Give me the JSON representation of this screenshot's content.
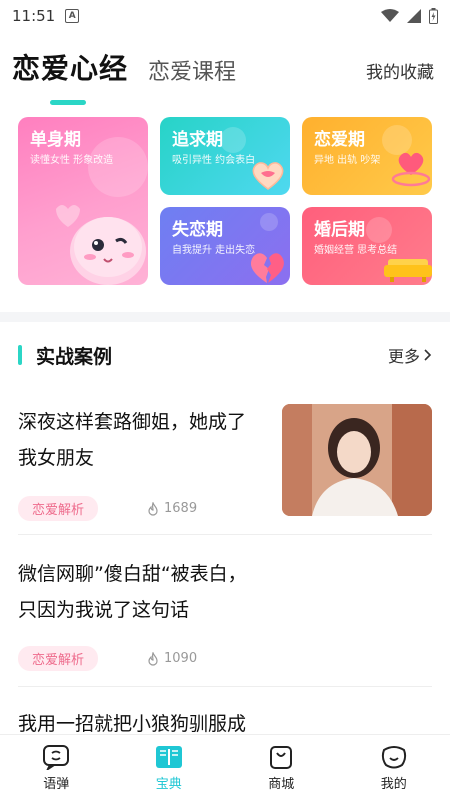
{
  "status": {
    "time": "11:51"
  },
  "nav": {
    "tab_main": "恋爱心经",
    "tab_second": "恋爱课程",
    "favorites": "我的收藏"
  },
  "categories": [
    {
      "title": "单身期",
      "subtitle": "读懂女性 形象改造"
    },
    {
      "title": "追求期",
      "subtitle": "吸引异性 约会表白"
    },
    {
      "title": "恋爱期",
      "subtitle": "异地 出轨 吵架"
    },
    {
      "title": "失恋期",
      "subtitle": "自我提升 走出失恋"
    },
    {
      "title": "婚后期",
      "subtitle": "婚姻经营 思考总结"
    }
  ],
  "section": {
    "title": "实战案例",
    "more": "更多"
  },
  "articles": [
    {
      "line1": "深夜这样套路御姐，她成了",
      "line2": "我女朋友",
      "tag": "恋爱解析",
      "views": "1689"
    },
    {
      "line1": "微信网聊”傻白甜“被表白，",
      "line2": "只因为我说了这句话",
      "tag": "恋爱解析",
      "views": "1090"
    },
    {
      "line1": "我用一招就把小狼狗驯服成",
      "line2": "",
      "tag": "",
      "views": ""
    }
  ],
  "bottom_nav": [
    {
      "label": "语弹",
      "icon": "chat-bubble-icon"
    },
    {
      "label": "宝典",
      "icon": "book-icon",
      "active": true
    },
    {
      "label": "商城",
      "icon": "shopping-bag-icon"
    },
    {
      "label": "我的",
      "icon": "smiley-face-icon"
    }
  ],
  "colors": {
    "accent": "#2bd6c6",
    "active_nav": "#1fc7d4",
    "tag_text": "#ee6b8c"
  }
}
